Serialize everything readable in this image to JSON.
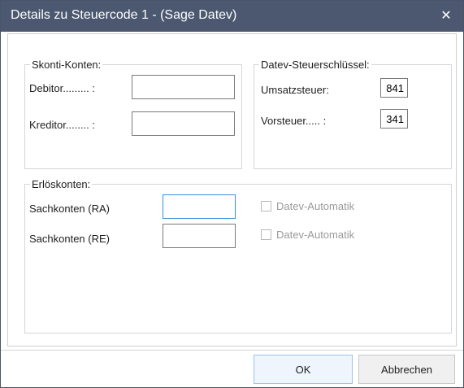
{
  "window": {
    "title": "Details zu Steuercode 1 - (Sage Datev)",
    "close_glyph": "✕"
  },
  "skonti": {
    "legend": "Skonti-Konten:",
    "debitor_label": "Debitor......... :",
    "debitor_value": "",
    "kreditor_label": "Kreditor........ :",
    "kreditor_value": ""
  },
  "datev": {
    "legend": "Datev-Steuerschlüssel:",
    "umsatzsteuer_label": "Umsatzsteuer:",
    "umsatzsteuer_value": "841",
    "vorsteuer_label": "Vorsteuer..... :",
    "vorsteuer_value": "341"
  },
  "erloes": {
    "legend": "Erlöskonten:",
    "ra_label": "Sachkonten (RA)",
    "ra_value": "",
    "re_label": "Sachkonten (RE)",
    "re_value": "",
    "auto_ra_label": "Datev-Automatik",
    "auto_re_label": "Datev-Automatik"
  },
  "buttons": {
    "ok": "OK",
    "cancel": "Abbrechen"
  },
  "colors": {
    "titlebar": "#4b5870",
    "focus_border": "#3c8ed8"
  }
}
